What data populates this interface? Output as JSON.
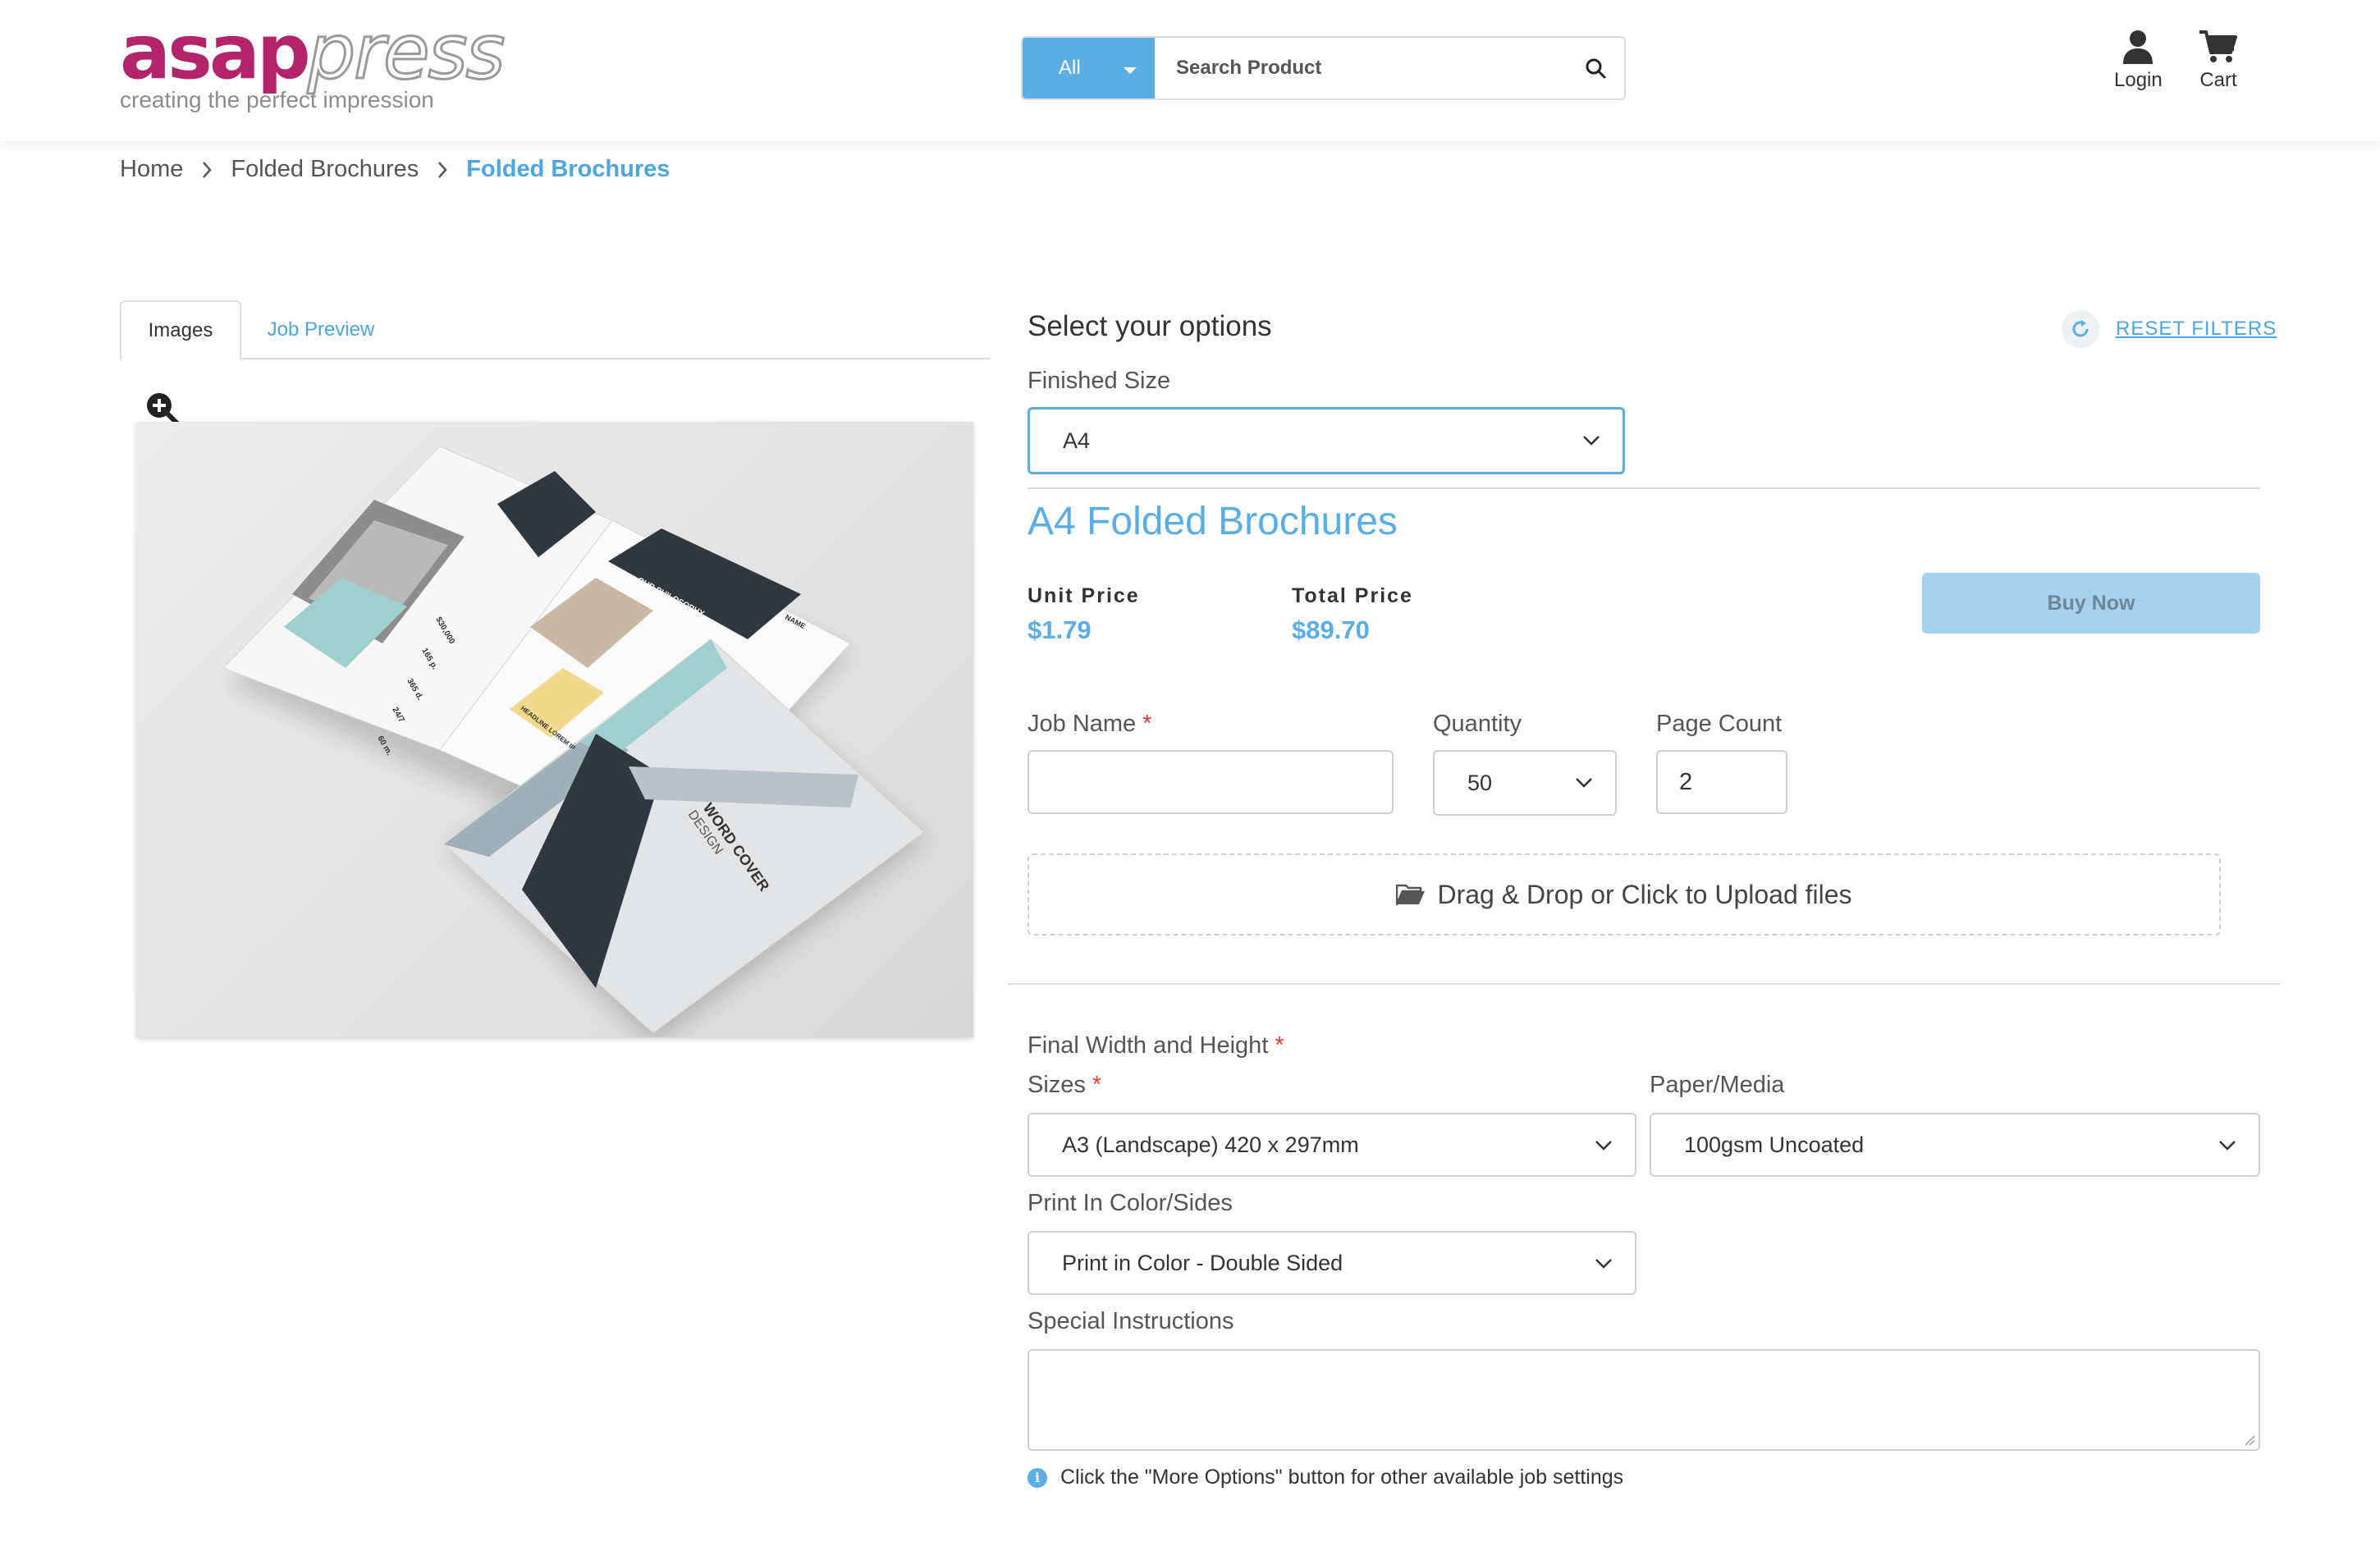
{
  "header": {
    "logo": {
      "part1": "asap",
      "part2": "press",
      "tagline": "creating the perfect impression"
    },
    "search": {
      "category": "All",
      "placeholder": "Search Product"
    },
    "login_label": "Login",
    "cart_label": "Cart"
  },
  "breadcrumb": [
    "Home",
    "Folded Brochures",
    "Folded Brochures"
  ],
  "tabs": [
    "Images",
    "Job Preview"
  ],
  "options": {
    "title": "Select your options",
    "reset_label": "RESET FILTERS",
    "finished_size_label": "Finished Size",
    "finished_size_value": "A4",
    "product_heading": "A4 Folded Brochures",
    "unit_price_label": "Unit Price",
    "unit_price": "$1.79",
    "total_price_label": "Total Price",
    "total_price": "$89.70",
    "buy_label": "Buy Now",
    "job_name_label": "Job Name",
    "job_name_value": "",
    "required_mark": "*",
    "quantity_label": "Quantity",
    "quantity_value": "50",
    "page_count_label": "Page Count",
    "page_count_value": "2",
    "upload_label": "Drag & Drop or Click to Upload files",
    "final_wh_label": "Final Width and Height",
    "sizes_label": "Sizes",
    "sizes_value": "A3 (Landscape) 420 x 297mm",
    "paper_label": "Paper/Media",
    "paper_value": "100gsm Uncoated",
    "color_label": "Print In Color/Sides",
    "color_value": "Print in Color - Double Sided",
    "special_label": "Special Instructions",
    "note": "Click the \"More Options\" button for other available job settings"
  },
  "image_texts": {
    "cover_title": "WORD COVER",
    "cover_sub": "DESIGN",
    "inner_heading": "OUR PHILOSOPHY",
    "inner_name": "NAME",
    "headline": "HEADLINE LOREM IP",
    "price1": "$30,000",
    "price2": "165 p.",
    "price3": "365 d.",
    "price4": "24/7",
    "price5": "60 m."
  },
  "colors": {
    "brand": "#b3246b",
    "accent": "#5aaee3",
    "buy_disabled": "#a7d2ef",
    "required": "#e23c3c"
  }
}
